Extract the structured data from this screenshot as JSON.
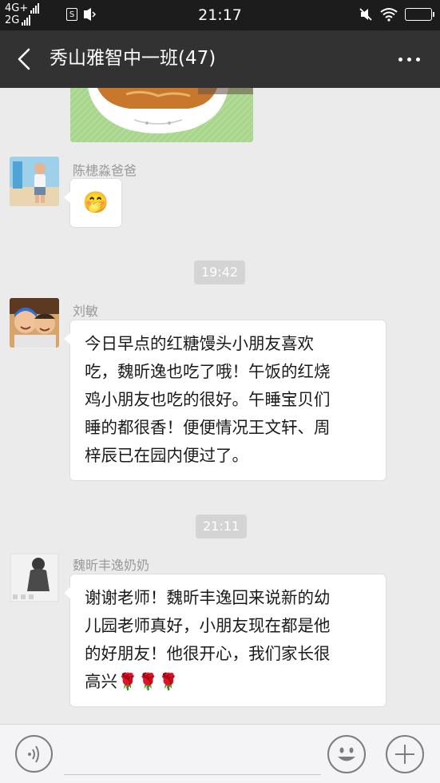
{
  "status_bar": {
    "network_top": "4G+",
    "network_bottom": "2G",
    "sim_label": "S",
    "time": "21:17"
  },
  "header": {
    "title": "秀山雅智中一班(47)"
  },
  "messages": [
    {
      "type": "image",
      "icon": "food-bowl-photo"
    },
    {
      "type": "text",
      "sender": "陈槵淼爸爸",
      "avatar": "child-avatar",
      "content": "🤭"
    },
    {
      "type": "time",
      "text": "19:42"
    },
    {
      "type": "text",
      "sender": "刘敏",
      "avatar": "children-avatar",
      "content": "今日早点的红糖馒头小朋友喜欢\n吃，魏昕逸也吃了哦！午饭的红烧\n鸡小朋友也吃的很好。午睡宝贝们\n睡的都很香！便便情况王文轩、周\n梓辰已在园内便过了。"
    },
    {
      "type": "time",
      "text": "21:11"
    },
    {
      "type": "text",
      "sender": "魏昕丰逸奶奶",
      "avatar": "woman-avatar",
      "content": "谢谢老师！魏昕丰逸回来说新的幼\n儿园老师真好，小朋友现在都是他\n的好朋友！他很开心，我们家长很\n高兴🌹🌹🌹"
    }
  ],
  "input_bar": {
    "voice_icon": "voice-icon",
    "emoji_icon": "emoji-icon",
    "plus_icon": "plus-icon",
    "placeholder": ""
  }
}
